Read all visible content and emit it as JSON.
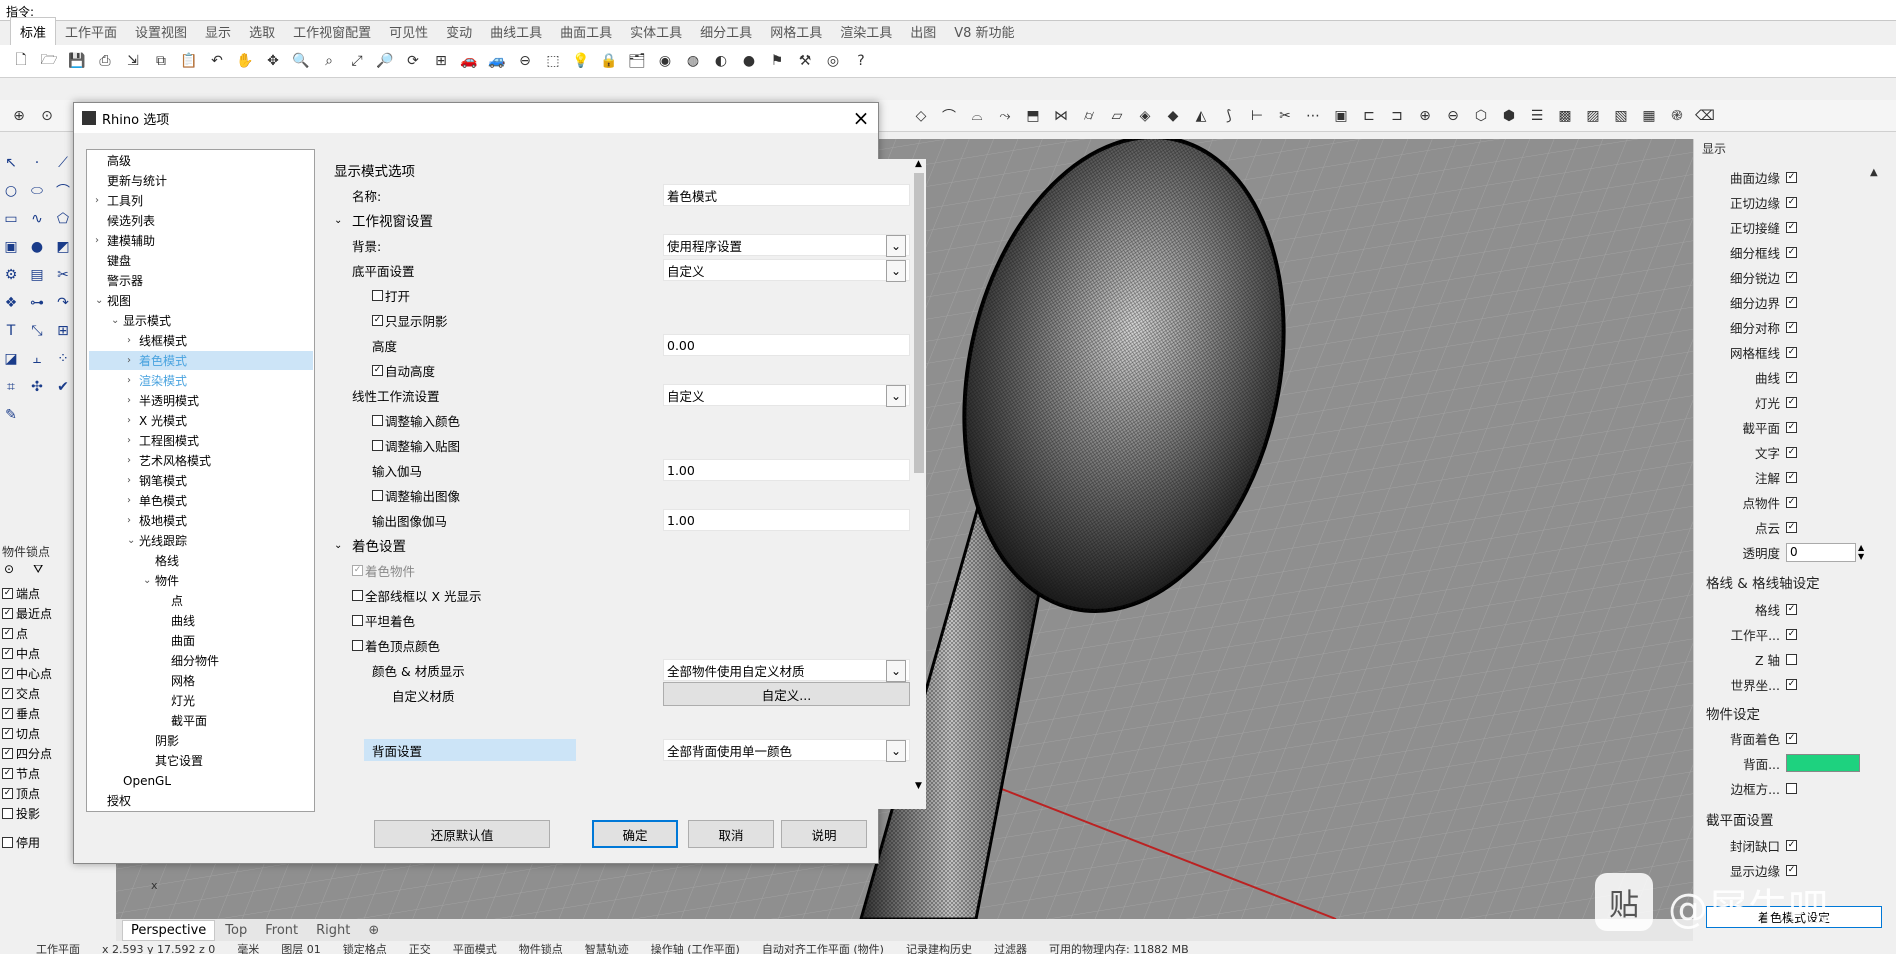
{
  "command": {
    "label": "指令:"
  },
  "menu_tabs": [
    "标准",
    "工作平面",
    "设置视图",
    "显示",
    "选取",
    "工作视窗配置",
    "可见性",
    "变动",
    "曲线工具",
    "曲面工具",
    "实体工具",
    "细分工具",
    "网格工具",
    "渲染工具",
    "出图",
    "V8 新功能"
  ],
  "viewport": {
    "tabs": [
      "Perspective",
      "Top",
      "Front",
      "Right"
    ],
    "add_tab_icon": "plus-icon"
  },
  "status": {
    "items": [
      "工作平面",
      "x 2.593  y 17.592  z 0",
      "毫米",
      "图层 01",
      "锁定格点",
      "正交",
      "平面模式",
      "物件锁点",
      "智慧轨迹",
      "操作轴 (工作平面)",
      "自动对齐工作平面 (物件)",
      "记录建构历史",
      "过滤器",
      "可用的物理内存: 11882 MB"
    ]
  },
  "osnap": {
    "title": "物件锁点",
    "items": [
      {
        "label": "端点",
        "checked": true
      },
      {
        "label": "最近点",
        "checked": true
      },
      {
        "label": "点",
        "checked": true
      },
      {
        "label": "中点",
        "checked": true
      },
      {
        "label": "中心点",
        "checked": true
      },
      {
        "label": "交点",
        "checked": true
      },
      {
        "label": "垂点",
        "checked": true
      },
      {
        "label": "切点",
        "checked": true
      },
      {
        "label": "四分点",
        "checked": true
      },
      {
        "label": "节点",
        "checked": true
      },
      {
        "label": "顶点",
        "checked": true
      },
      {
        "label": "投影",
        "checked": false
      }
    ],
    "disable_label": "停用"
  },
  "right_panel": {
    "header": "显示",
    "rows": [
      {
        "label": "曲面边缘",
        "checked": true
      },
      {
        "label": "正切边缘",
        "checked": true
      },
      {
        "label": "正切接缝",
        "checked": true
      },
      {
        "label": "细分框线",
        "checked": true
      },
      {
        "label": "细分锐边",
        "checked": true
      },
      {
        "label": "细分边界",
        "checked": true
      },
      {
        "label": "细分对称",
        "checked": true
      },
      {
        "label": "网格框线",
        "checked": true
      },
      {
        "label": "曲线",
        "checked": true
      },
      {
        "label": "灯光",
        "checked": true
      },
      {
        "label": "截平面",
        "checked": true
      },
      {
        "label": "文字",
        "checked": true
      },
      {
        "label": "注解",
        "checked": true
      },
      {
        "label": "点物件",
        "checked": true
      },
      {
        "label": "点云",
        "checked": true
      }
    ],
    "transparency_label": "透明度",
    "transparency_value": "0",
    "grid_section": "格线 & 格线轴设定",
    "grid_rows": [
      {
        "label": "格线",
        "checked": true
      },
      {
        "label": "工作平...",
        "checked": true
      },
      {
        "label": "Z 轴",
        "checked": false
      },
      {
        "label": "世界坐...",
        "checked": true
      }
    ],
    "object_section": "物件设定",
    "object_rows": [
      {
        "label": "背面着色",
        "checked": true
      }
    ],
    "backface_color_label": "背面...",
    "backface_color": "#1ed27f",
    "bbox_label": "边框方...",
    "bbox_checked": false,
    "clip_section": "截平面设置",
    "clip_rows": [
      {
        "label": "封闭缺口",
        "checked": true
      },
      {
        "label": "显示边缘",
        "checked": true
      }
    ],
    "bottom_button": "着色模式设定"
  },
  "dialog": {
    "title": "Rhino 选项",
    "tree": [
      {
        "label": "高级",
        "level": 1,
        "arrow": ""
      },
      {
        "label": "更新与统计",
        "level": 1,
        "arrow": ""
      },
      {
        "label": "工具列",
        "level": 1,
        "arrow": "›"
      },
      {
        "label": "候选列表",
        "level": 1,
        "arrow": ""
      },
      {
        "label": "建模辅助",
        "level": 1,
        "arrow": "›"
      },
      {
        "label": "键盘",
        "level": 1,
        "arrow": ""
      },
      {
        "label": "警示器",
        "level": 1,
        "arrow": ""
      },
      {
        "label": "视图",
        "level": 1,
        "arrow": "⌄"
      },
      {
        "label": "显示模式",
        "level": 2,
        "arrow": "⌄"
      },
      {
        "label": "线框模式",
        "level": 3,
        "arrow": "›"
      },
      {
        "label": "着色模式",
        "level": 3,
        "arrow": "›",
        "selected": true
      },
      {
        "label": "渲染模式",
        "level": 3,
        "arrow": "›",
        "link": true
      },
      {
        "label": "半透明模式",
        "level": 3,
        "arrow": "›"
      },
      {
        "label": "X 光模式",
        "level": 3,
        "arrow": "›"
      },
      {
        "label": "工程图模式",
        "level": 3,
        "arrow": "›"
      },
      {
        "label": "艺术风格模式",
        "level": 3,
        "arrow": "›"
      },
      {
        "label": "钢笔模式",
        "level": 3,
        "arrow": "›"
      },
      {
        "label": "单色模式",
        "level": 3,
        "arrow": "›"
      },
      {
        "label": "极地模式",
        "level": 3,
        "arrow": "›"
      },
      {
        "label": "光线跟踪",
        "level": 3,
        "arrow": "⌄"
      },
      {
        "label": "格线",
        "level": 4,
        "arrow": ""
      },
      {
        "label": "物件",
        "level": 4,
        "arrow": "⌄"
      },
      {
        "label": "点",
        "level": 5,
        "arrow": ""
      },
      {
        "label": "曲线",
        "level": 5,
        "arrow": ""
      },
      {
        "label": "曲面",
        "level": 5,
        "arrow": ""
      },
      {
        "label": "细分物件",
        "level": 5,
        "arrow": ""
      },
      {
        "label": "网格",
        "level": 5,
        "arrow": ""
      },
      {
        "label": "灯光",
        "level": 5,
        "arrow": ""
      },
      {
        "label": "截平面",
        "level": 5,
        "arrow": ""
      },
      {
        "label": "阴影",
        "level": 4,
        "arrow": ""
      },
      {
        "label": "其它设置",
        "level": 4,
        "arrow": ""
      },
      {
        "label": "OpenGL",
        "level": 2,
        "arrow": ""
      },
      {
        "label": "授权",
        "level": 1,
        "arrow": ""
      }
    ],
    "options": {
      "section_title": "显示模式选项",
      "name_label": "名称:",
      "name_value": "着色模式",
      "viewport_section": "工作视窗设置",
      "background_label": "背景:",
      "background_value": "使用程序设置",
      "ground_label": "底平面设置",
      "ground_value": "自定义",
      "on_label": "打开",
      "on_checked": false,
      "shadow_only_label": "只显示阴影",
      "shadow_only_checked": true,
      "height_label": "高度",
      "height_value": "0.00",
      "auto_height_label": "自动高度",
      "auto_height_checked": true,
      "linear_label": "线性工作流设置",
      "linear_value": "自定义",
      "adj_input_color_label": "调整输入颜色",
      "adj_input_color_checked": false,
      "adj_input_tex_label": "调整输入贴图",
      "adj_input_tex_checked": false,
      "input_gamma_label": "输入伽马",
      "input_gamma_value": "1.00",
      "adj_output_label": "调整输出图像",
      "adj_output_checked": false,
      "output_gamma_label": "输出图像伽马",
      "output_gamma_value": "1.00",
      "shading_section": "着色设置",
      "shade_objects_label": "着色物件",
      "shade_objects_checked": true,
      "xray_label": "全部线框以 X 光显示",
      "xray_checked": false,
      "flat_label": "平坦着色",
      "flat_checked": false,
      "vertex_color_label": "着色顶点颜色",
      "vertex_color_checked": false,
      "color_material_label": "颜色 & 材质显示",
      "color_material_value": "全部物件使用自定义材质",
      "custom_material_label": "自定义材质",
      "custom_material_button": "自定义...",
      "backface_label": "背面设置",
      "backface_value": "全部背面使用单一颜色"
    },
    "buttons": {
      "restore": "还原默认值",
      "ok": "确定",
      "cancel": "取消",
      "help": "说明"
    }
  },
  "watermark": "@犀牛吧"
}
